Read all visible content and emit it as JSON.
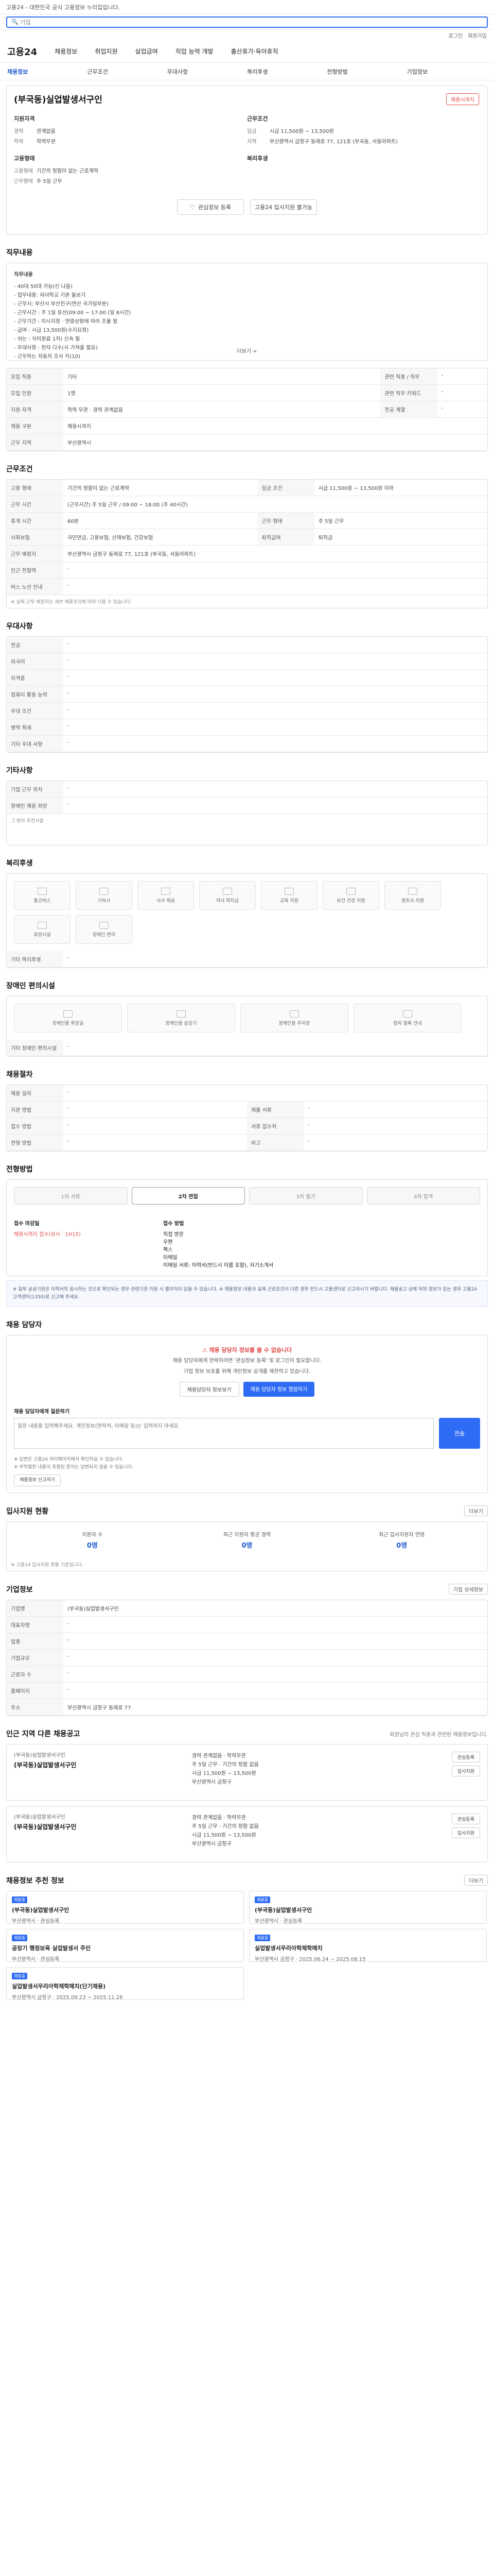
{
  "topbar": {
    "notice": "고용24 - 대한민국 공식 고용정보 누리집입니다."
  },
  "search": {
    "placeholder": "기업"
  },
  "util": [
    "로그인",
    "회원가입"
  ],
  "gnb": {
    "logo": "고용24",
    "menus": [
      "채용정보",
      "취업지원",
      "실업급여",
      "직업 능력 개발",
      "출산휴가·육아휴직"
    ]
  },
  "lnb": [
    "채용정보",
    "근무조건",
    "우대사항",
    "복리후생",
    "전형방법",
    "기업정보"
  ],
  "head": {
    "company": "(부국동)실업발생서구인",
    "badge": "채용시까지",
    "left_title": "지원자격",
    "left": [
      {
        "k": "경력",
        "v": "관계없음"
      },
      {
        "k": "학력",
        "v": "학력무관"
      }
    ],
    "left2_title": "고용형태",
    "left2": [
      {
        "k": "고용형태",
        "v": "기간의 정함이 없는 근로계약"
      },
      {
        "k": "근무형태",
        "v": "주 5일 근무"
      }
    ],
    "right_title": "근무조건",
    "right": [
      {
        "k": "임금",
        "v": "시급 11,500원 ~ 13,500원"
      },
      {
        "k": "지역",
        "v": "부산광역시 금정구 동래로 77, 121호 (부곡동, 서동아파트)"
      }
    ],
    "right2_title": "복리후생",
    "actions": [
      "관심정보 등록",
      "고용24 입사지원 불가능"
    ]
  },
  "jobdesc": {
    "title": "직무내용",
    "label": "직무내용",
    "lines": [
      "- 40대 50대 가능(신 나음)",
      "- 업무내용: 자녀학교 기본 돌보기",
      "- 근무시: 부산시 부산진구(연산 국가일부분)",
      "- 근무시간 : 주 1일 유선(09:00 ~ 17:00 (일 8시간)",
      "- 근무기간 : 미시지정 · 연중상황에 따라 조율 필",
      "- 급여 : 시급 13,500원(수지요청)",
      "- 쉬는 : 식이원료 1차) 신속 필 ·",
      "- 우대사항 : 한자 다수(시 가져올 필요)",
      "- 근무하는 자동차 조사 키(10)"
    ],
    "more": "더보기 +"
  },
  "basic_table": [
    [
      "모집 직종",
      "기타",
      "관련 직종 / 직무",
      "-"
    ],
    [
      "모집 인원",
      "1명",
      "관련 직무 키워드",
      "-"
    ],
    [
      "지원 자격",
      "학력 무관 · 경력 관계없음",
      "전공 계열",
      "-"
    ],
    [
      "채용 구분",
      "채용시까지",
      "",
      ""
    ],
    [
      "근무 지역",
      "부산광역시",
      "",
      ""
    ]
  ],
  "conditions": {
    "title": "근무조건",
    "rows": [
      [
        "고용 형태",
        "기간의 정함이 없는 근로계약",
        "임금 조건",
        "시급 11,500원 ~ 13,500원 이하"
      ],
      [
        "근무 시간",
        "(근무시간) 주 5일 근무 / 09:00 ~ 18:00 (주 40시간)",
        "",
        ""
      ],
      [
        "휴게 시간",
        "60분",
        "근무 형태",
        "주 5일 근무"
      ],
      [
        "사회보험",
        "국민연금, 고용보험, 산재보험, 건강보험",
        "퇴직급여",
        "퇴직금"
      ],
      [
        "근무 예정지",
        "부산광역시 금정구 동래로 77, 121호 (부곡동, 서동아파트)",
        "",
        ""
      ],
      [
        "인근 전철역",
        "-",
        "",
        ""
      ],
      [
        "버스 노선 안내",
        "-",
        "",
        ""
      ]
    ],
    "note": "※ 실제 근무 예정지는 세부 채용조건에 따라 다를 수 있습니다."
  },
  "prefer": {
    "title": "우대사항",
    "rows": [
      [
        "전공",
        "-"
      ],
      [
        "외국어",
        "-"
      ],
      [
        "자격증",
        "-"
      ],
      [
        "컴퓨터 활용 능력",
        "-"
      ],
      [
        "우대 조건",
        "-"
      ],
      [
        "병역 특례",
        "-"
      ],
      [
        "기타 우대 사항",
        "-"
      ]
    ]
  },
  "etc": {
    "title": "기타사항",
    "rows": [
      [
        "기업 근무 위치",
        "-"
      ],
      [
        "장애인 채용 희망",
        "-"
      ]
    ],
    "note": "그 밖의 추천사항"
  },
  "welfare": {
    "title": "복리후생",
    "items": [
      "통근버스",
      "기숙사",
      "식사 제공",
      "자녀 학자금",
      "교육 지원",
      "보건 건강 지원",
      "경조사 지원",
      "휴양시설",
      "장애인 편의"
    ],
    "etc": "기타 복리후생"
  },
  "disabled": {
    "title": "장애인 편의시설",
    "items": [
      "장애인용 화장실",
      "장애인용 승강기",
      "장애인용 주차장",
      "점자 블록 안내"
    ],
    "etc": "기타 장애인 편의시설"
  },
  "hiring": {
    "title": "채용절차",
    "rows": [
      [
        "채용 일자",
        "-"
      ],
      [
        "지원 방법",
        "-",
        "제출 서류",
        "-"
      ],
      [
        "접수 방법",
        "-",
        "서류 접수처",
        "-"
      ],
      [
        "전형 방법",
        "-",
        "비고",
        "-"
      ]
    ]
  },
  "process": {
    "title": "전형방법",
    "steps": [
      "1차 서류",
      "2차 면접",
      "3차 필기",
      "4차 합격"
    ],
    "info_left_label": "접수 마감일",
    "info_left_value": "채용시까지 접수(상시 · 1H15)",
    "info_right_label": "접수 방법",
    "info_right_items": [
      "직접 방문",
      "우편",
      "팩스",
      "이메일",
      "이메일 서류: 이력서(반드시 이름 포함), 자기소개서"
    ],
    "warn": "※ 일부 공공기관은 이력서의 응시하는 것으로 확인되는 경우 관련기관 지원 시 불이익이 있을 수 있습니다. ※ 채용정보 내용과 실제 근로조건이 다른 경우 반드시 고용센터로 신고하시기 바랍니다. 채용공고 상에 허위 정보가 있는 경우 고용24 고객센터(1350)로 신고해 주세요."
  },
  "contact": {
    "title": "채용 담당자",
    "red": "채용 담당자 정보를 볼 수 없습니다",
    "desc1": "채용 담당자에게 연락하려면 '관심정보 등록' 및 로그인이 필요합니다.",
    "desc2": "기업 정보 보호를 위해 개인정보 공개를 제한하고 있습니다.",
    "btn1": "채용담당자 정보보기",
    "btn2": "채용 담당자 정보 열람하기",
    "q_label": "채용 담당자에게 질문하기",
    "q_placeholder": "질문 내용을 입력해주세요. 개인정보(연락처, 이메일 등)는 입력하지 마세요.",
    "q_send": "전송",
    "notes": [
      "※ 답변은 고용24 마이페이지에서 확인하실 수 있습니다.",
      "※ 부적절한 내용이 포함된 문의는 답변되지 않을 수 있습니다."
    ],
    "report_btn": "채용정보 신고하기"
  },
  "stats": {
    "title": "입사지원 현황",
    "more_label": "더보기",
    "items": [
      {
        "label": "지원자 수",
        "value": "0명"
      },
      {
        "label": "최근 지원자 평균 경력",
        "value": "0명"
      },
      {
        "label": "최근 입사지원자 연령",
        "value": "0명"
      }
    ],
    "note": "※ 고용24 입사지원 현황 기준입니다."
  },
  "company_info": {
    "title": "기업정보",
    "btn": "기업 상세정보",
    "rows": [
      [
        "기업명",
        "(부국동)실업발생서구인"
      ],
      [
        "대표자명",
        "-"
      ],
      [
        "업종",
        "-"
      ],
      [
        "기업규모",
        "-"
      ],
      [
        "근로자 수",
        "-"
      ],
      [
        "홈페이지",
        "-"
      ],
      [
        "주소",
        "부산광역시 금정구 동래로 77"
      ]
    ]
  },
  "related": {
    "title": "인근 지역 다른 채용공고",
    "sub": "회원님의 관심 직종과 관련된 채용정보입니다.",
    "cards": [
      {
        "cname": "(부국동)실업발생서구인",
        "ctitle": "(부국동)실업발생서구인",
        "meta": [
          "경력 관계없음 · 학력무관",
          "주 5일 근무 · 기간의 정함 없음",
          "시급 11,500원 ~ 13,500원",
          "부산광역시 금정구"
        ],
        "btns": [
          "관심등록",
          "입사지원"
        ]
      },
      {
        "cname": "(부국동)실업발생서구인",
        "ctitle": "(부국동)실업발생서구인",
        "meta": [
          "경력 관계없음 · 학력무관",
          "주 5일 근무 · 기간의 정함 없음",
          "시급 11,500원 ~ 13,500원",
          "부산광역시 금정구"
        ],
        "btns": [
          "관심등록",
          "입사지원"
        ]
      }
    ]
  },
  "recent": {
    "title": "채용정보 추천 정보",
    "more_label": "더보기",
    "items": [
      {
        "tag": "채용중",
        "title": "(부국동)실업발생서구인",
        "meta": "부산광역시 · 관심등록"
      },
      {
        "tag": "채용중",
        "title": "(부국동)실업발생서구인",
        "meta": "부산광역시 · 관심등록"
      },
      {
        "tag": "채용중",
        "title": "공장기 행정보육 실업발생서 주인",
        "meta": "부산광역시 · 관심등록"
      },
      {
        "tag": "채용중",
        "title": "실업발생서우리아학제학매치",
        "meta": "부산광역시 금정구 · 2025.06.24 ~ 2025.08.15"
      },
      {
        "tag": "채용중",
        "title": "실업발생서우리아학제학매치(단기채용)",
        "meta": "부산광역시 금정구 · 2025.09.23 ~ 2025.11.26"
      }
    ]
  }
}
